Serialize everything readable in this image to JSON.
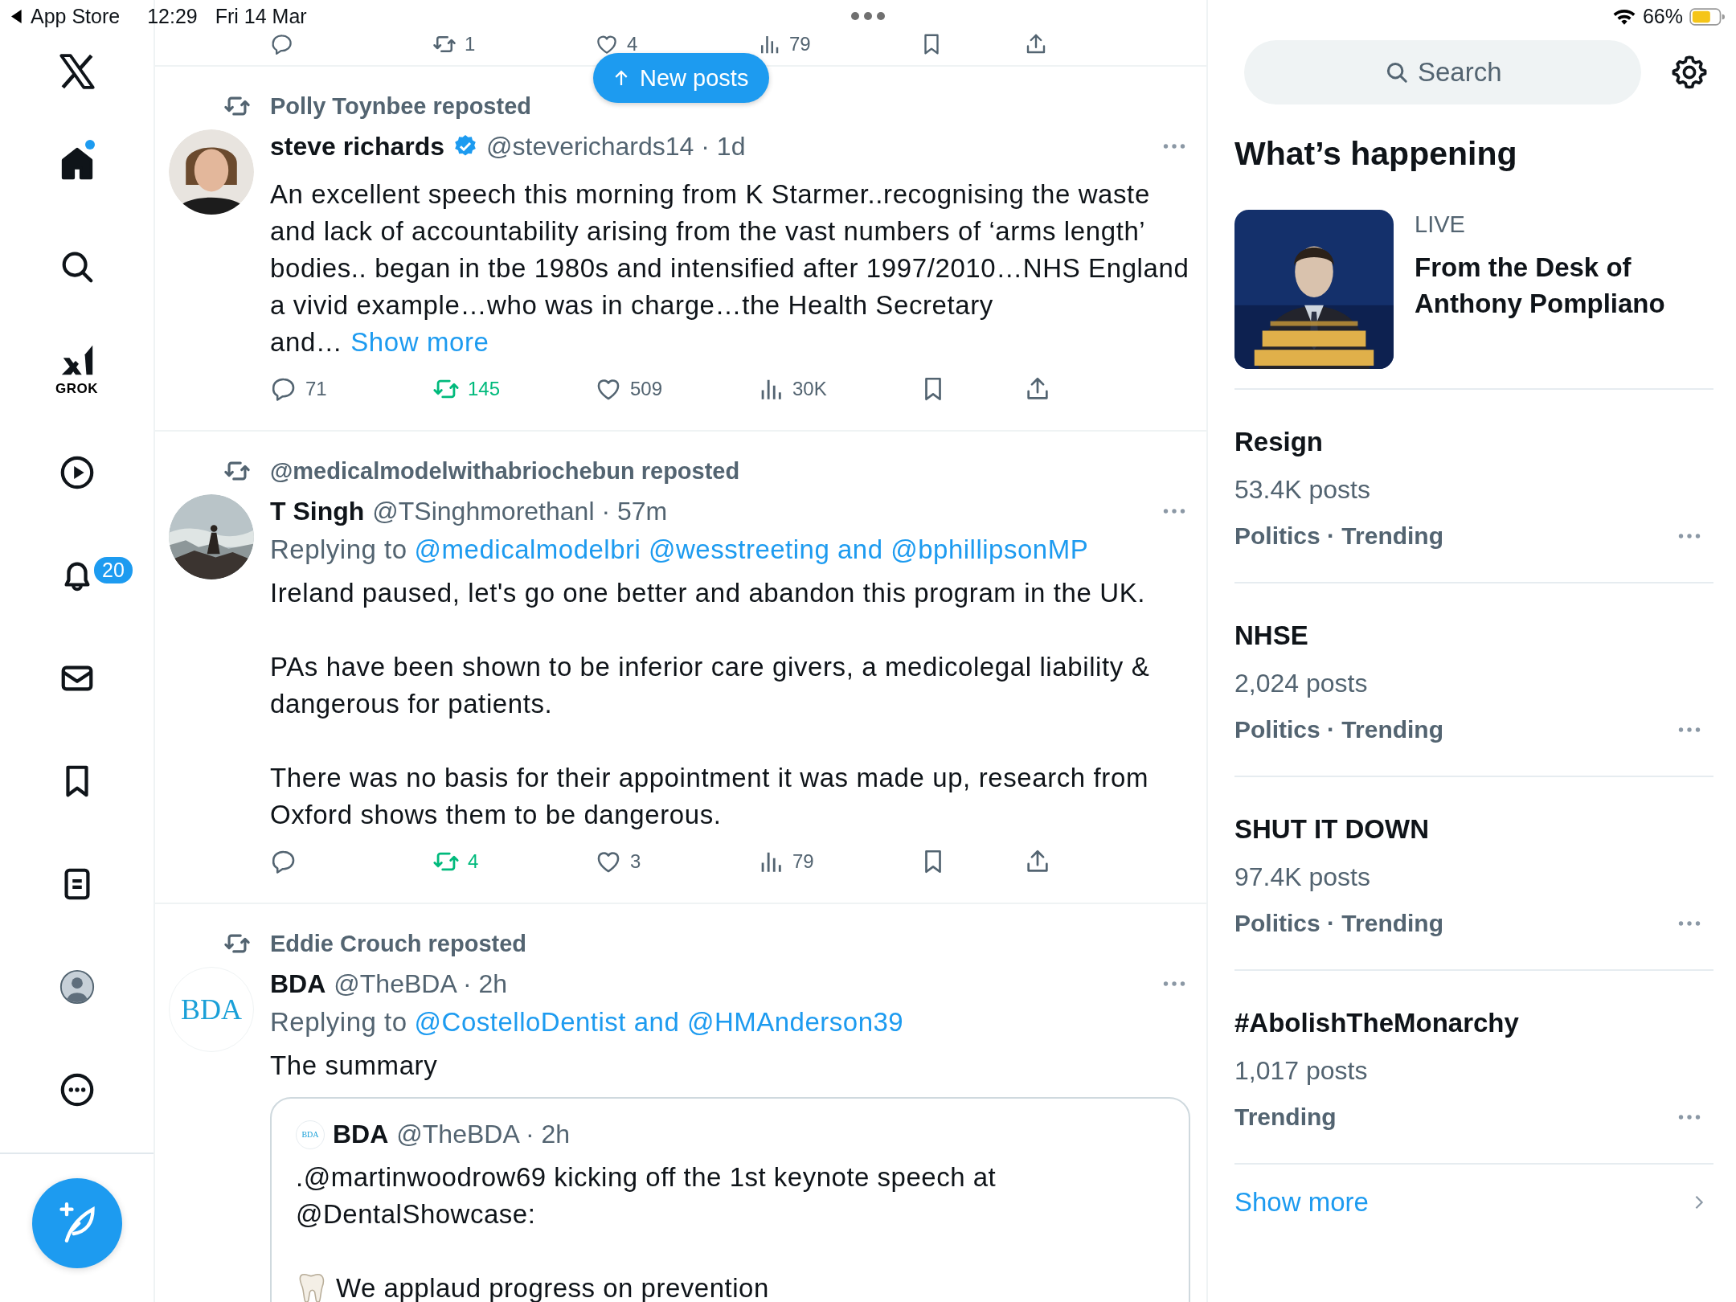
{
  "status_bar": {
    "back_label": "App Store",
    "time": "12:29",
    "date": "Fri 14 Mar",
    "battery": "66%"
  },
  "sidebar": {
    "items": [
      {
        "kind": "home",
        "selected": true,
        "unread": true
      },
      {
        "kind": "search",
        "selected": false
      },
      {
        "kind": "grok",
        "selected": false,
        "label": "GROK"
      },
      {
        "kind": "video",
        "selected": false
      },
      {
        "kind": "notifications",
        "selected": false,
        "badge": "20"
      },
      {
        "kind": "messages",
        "selected": false
      },
      {
        "kind": "bookmarks",
        "selected": false
      },
      {
        "kind": "lists",
        "selected": false
      },
      {
        "kind": "profile",
        "selected": false
      },
      {
        "kind": "more",
        "selected": false
      }
    ]
  },
  "new_posts_button": "New posts",
  "previous_post_actions": {
    "reposted": false,
    "repost": "1",
    "like": "4",
    "views": "79"
  },
  "posts": [
    {
      "reposted_by": "Polly Toynbee reposted",
      "avatar": {
        "kind": "person"
      },
      "name": "steve richards",
      "verified": true,
      "meta": "@steverichards14 · 1d",
      "paragraphs": [
        "An excellent speech this morning from K Starmer..recognising the waste and lack of accountability arising from the vast numbers of ‘arms length’ bodies.. began in tbe 1980s and intensified after 1997/2010…NHS England a vivid example…who was in charge…the Health Secretary and…"
      ],
      "show_more": "Show more",
      "actions": {
        "reply": "71",
        "repost": "145",
        "like": "509",
        "views": "30K"
      },
      "reposted": true
    },
    {
      "reposted_by": "@medicalmodelwithabriochebun reposted",
      "avatar": {
        "kind": "picture"
      },
      "name": "T Singh",
      "verified": false,
      "meta": "@TSinghmorethanl · 57m",
      "replying_prefix": "Replying to",
      "replying_to": "@medicalmodelbri @wesstreeting and @bphillipsonMP",
      "paragraphs": [
        "Ireland paused, let's go one better and abandon this program in the UK.",
        "PAs have been shown to be inferior care givers, a medicolegal liability & dangerous for patients.",
        "There was no basis for their appointment it was made up, research from Oxford shows them to be dangerous."
      ],
      "actions": {
        "repost": "4",
        "like": "3",
        "views": "79"
      },
      "reposted": true
    },
    {
      "reposted_by": "Eddie Crouch reposted",
      "avatar": {
        "kind": "logo",
        "text": "BDA"
      },
      "name": "BDA",
      "verified": false,
      "meta": "@TheBDA · 2h",
      "replying_prefix": "Replying to",
      "replying_to": "@CostelloDentist and @HMAnderson39",
      "paragraphs": [
        "The summary"
      ],
      "quote": {
        "avatar_text": "BDA",
        "name": "BDA",
        "meta": "@TheBDA · 2h",
        "lines": [
          {
            "kind": "text",
            "text": ".@martinwoodrow69 kicking off the 1st keynote speech at @DentalShowcase:"
          },
          {
            "kind": "tooth",
            "text": "We applaud progress on prevention"
          }
        ]
      }
    }
  ],
  "right_panel": {
    "search": {
      "placeholder": "Search"
    },
    "heading": "What’s happening",
    "live": {
      "label": "LIVE",
      "title": "From the Desk of Anthony Pompliano"
    },
    "trends": [
      {
        "title": "Resign",
        "count": "53.4K posts",
        "context": "Politics · Trending"
      },
      {
        "title": "NHSE",
        "count": "2,024 posts",
        "context": "Politics · Trending"
      },
      {
        "title": "SHUT IT DOWN",
        "count": "97.4K posts",
        "context": "Politics · Trending"
      },
      {
        "title": "#AbolishTheMonarchy",
        "count": "1,017 posts",
        "context": "Trending"
      }
    ],
    "show_more": "Show more"
  }
}
